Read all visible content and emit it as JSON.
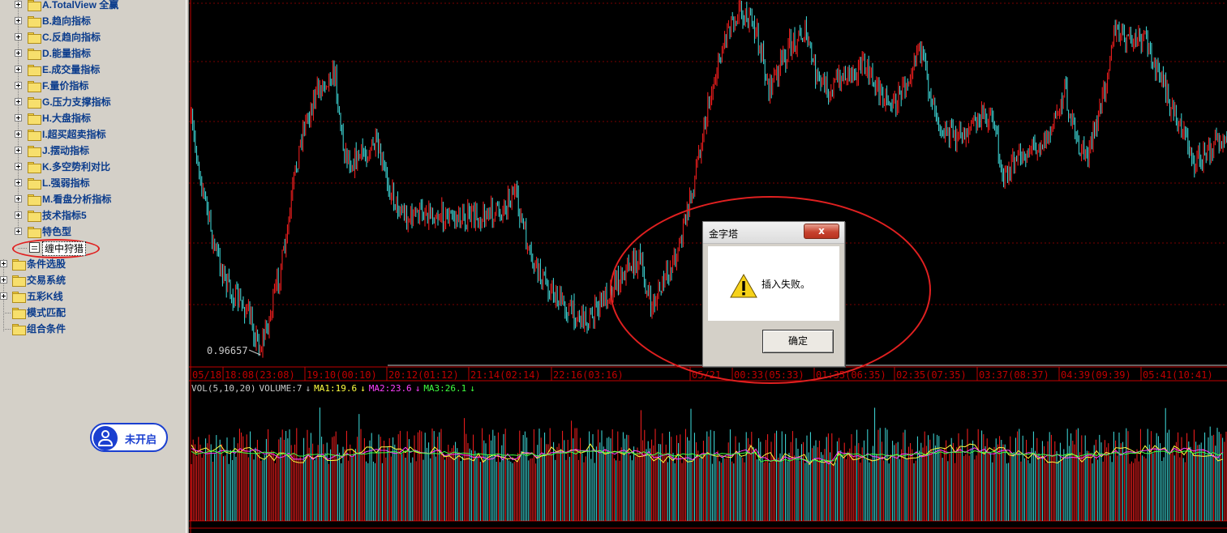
{
  "tree": {
    "indicator_groups": [
      {
        "label": "A.TotalView 全赢"
      },
      {
        "label": "B.趋向指标"
      },
      {
        "label": "C.反趋向指标"
      },
      {
        "label": "D.能量指标"
      },
      {
        "label": "E.成交量指标"
      },
      {
        "label": "F.量价指标"
      },
      {
        "label": "G.压力支撑指标"
      },
      {
        "label": "H.大盘指标"
      },
      {
        "label": "I.超买超卖指标"
      },
      {
        "label": "J.摆动指标"
      },
      {
        "label": "K.多空势利对比"
      },
      {
        "label": "L.强弱指标"
      },
      {
        "label": "M.看盘分析指标"
      },
      {
        "label": "技术指标5"
      },
      {
        "label": "特色型"
      }
    ],
    "selected_item": "缠中狩猎",
    "top_level": [
      {
        "label": "条件选股",
        "expandable": true
      },
      {
        "label": "交易系统",
        "expandable": true
      },
      {
        "label": "五彩K线",
        "expandable": true
      },
      {
        "label": "模式匹配",
        "expandable": false
      },
      {
        "label": "组合条件",
        "expandable": false
      }
    ]
  },
  "account_badge": {
    "label": "未开启",
    "icon": "user-icon"
  },
  "chart": {
    "low_label": "0.96657",
    "time_axis": [
      "05/18",
      "18:08(23:08)",
      "19:10(00:10)",
      "20:12(01:12)",
      "21:14(02:14)",
      "22:16(03:16)",
      "05/21",
      "00:33(05:33)",
      "01:35(06:35)",
      "02:35(07:35)",
      "03:37(08:37)",
      "04:39(09:39)",
      "05:41(10:41)"
    ],
    "colors": {
      "up": "#ff2020",
      "down": "#40e0e0",
      "axis": "#c00000",
      "grid": "#7a0000",
      "ma1": "#ffff40",
      "ma2": "#ff40ff",
      "ma3": "#40ff40"
    }
  },
  "volume_legend": {
    "name": "VOL(5,10,20)",
    "volume": "VOLUME:7",
    "ma1": "MA1:19.6",
    "ma2": "MA2:23.6",
    "ma3": "MA3:26.1",
    "arrow": "↓"
  },
  "dialog": {
    "title": "金字塔",
    "close_label": "x",
    "message": "插入失败。",
    "ok_label": "确定",
    "icon": "warning-icon"
  }
}
